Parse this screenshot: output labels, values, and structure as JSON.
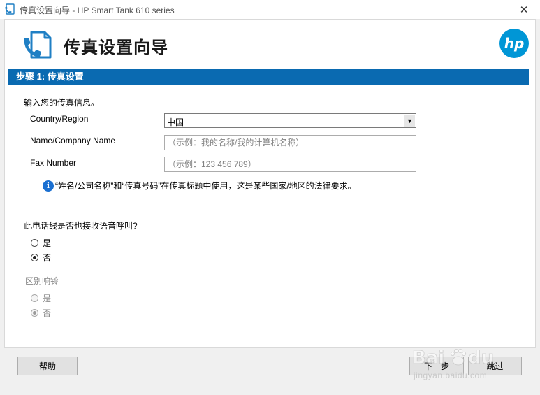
{
  "window": {
    "title": "传真设置向导 - HP Smart Tank 610 series",
    "close_glyph": "✕"
  },
  "header": {
    "heading": "传真设置向导"
  },
  "step_bar": {
    "label": "步骤 1: 传真设置"
  },
  "form": {
    "intro": "输入您的传真信息。",
    "country_label": "Country/Region",
    "country_value": "中国",
    "name_label": "Name/Company Name",
    "name_placeholder": "（示例：我的名称/我的计算机名称）",
    "fax_label": "Fax Number",
    "fax_placeholder": "（示例：123 456 789）",
    "info_text": "“姓名/公司名称”和“传真号码”在传真标题中使用，这是某些国家/地区的法律要求。"
  },
  "voice_question": {
    "label": "此电话线是否也接收语音呼叫?",
    "options": [
      {
        "label": "是",
        "checked": false
      },
      {
        "label": "否",
        "checked": true
      }
    ]
  },
  "distinctive_ring": {
    "label": "区别响铃",
    "enabled": false,
    "options": [
      {
        "label": "是",
        "checked": false
      },
      {
        "label": "否",
        "checked": true
      }
    ]
  },
  "footer": {
    "help_label": "帮助",
    "next_label": "下一步",
    "skip_label": "跳过"
  },
  "watermark": {
    "url": "jingyan.baidu.com"
  },
  "colors": {
    "step_bar": "#0a6ab1",
    "hp_blue": "#0096d6",
    "info_blue": "#1a6fd1"
  },
  "icons": {
    "app": "fax-phone-icon",
    "header": "fax-phone-icon",
    "brand": "hp-logo-icon",
    "info": "info-icon",
    "dropdown": "chevron-down-icon",
    "close": "close-icon"
  }
}
